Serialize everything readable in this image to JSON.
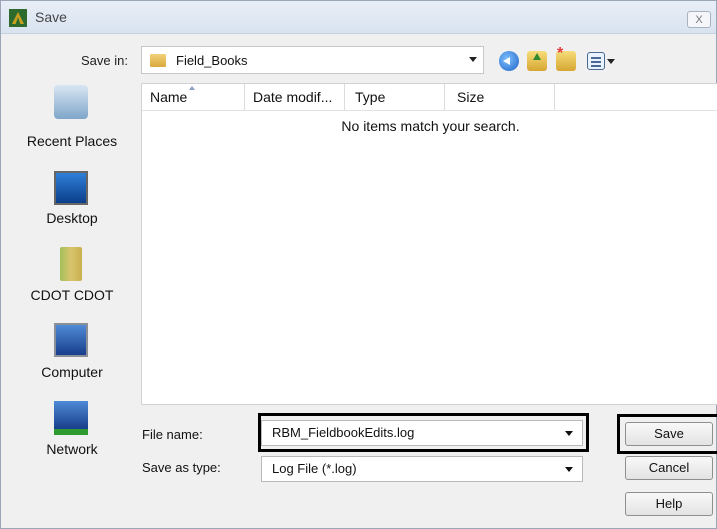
{
  "window": {
    "title": "Save",
    "close_label": "X"
  },
  "toolbar": {
    "save_in_label": "Save in:",
    "location": "Field_Books"
  },
  "places": [
    {
      "label": "Recent Places",
      "icon": "recent-places-icon"
    },
    {
      "label": "Desktop",
      "icon": "desktop-icon"
    },
    {
      "label": "CDOT CDOT",
      "icon": "user-folder-icon"
    },
    {
      "label": "Computer",
      "icon": "computer-icon"
    },
    {
      "label": "Network",
      "icon": "network-icon"
    }
  ],
  "filelist": {
    "columns": [
      "Name",
      "Date modif...",
      "Type",
      "Size"
    ],
    "empty_message": "No items match your search."
  },
  "form": {
    "file_name_label": "File name:",
    "file_name_value": "RBM_FieldbookEdits.log",
    "save_as_type_label": "Save as type:",
    "save_as_type_value": "Log File (*.log)"
  },
  "buttons": {
    "save": "Save",
    "cancel": "Cancel",
    "help": "Help"
  },
  "colors": {
    "highlight": "#000000",
    "dialog_bg": "#f0f0f0",
    "title_bar": "#dfe8f3"
  }
}
